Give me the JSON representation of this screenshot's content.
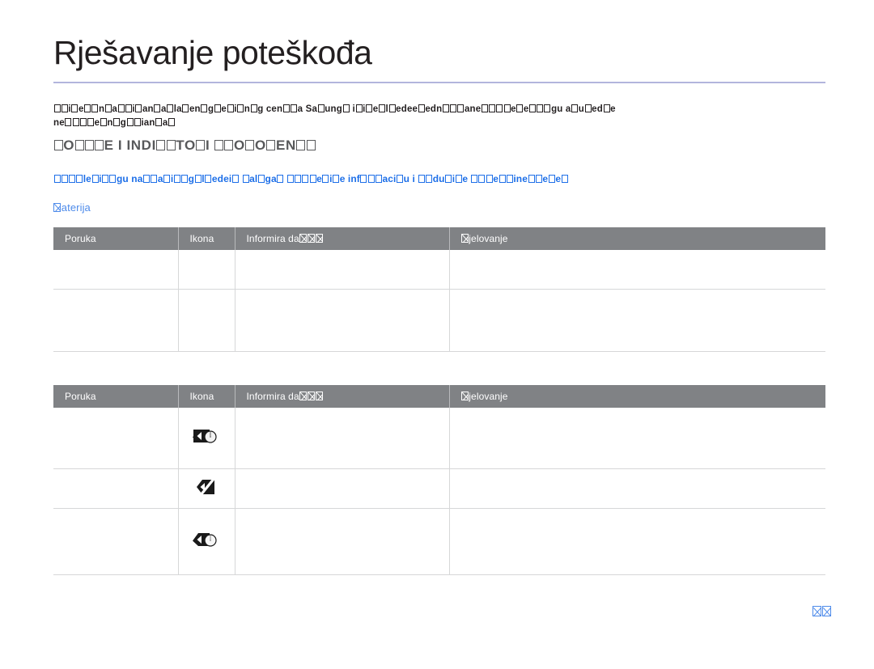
{
  "document": {
    "title": "Rješavanje poteškođa",
    "language": "hr",
    "rule_color": "#b2b5dd",
    "page_number_glyphs": 2
  },
  "intro": {
    "line1_parts": [
      {
        "t": "tofu",
        "n": 2
      },
      {
        "t": "text",
        "v": "i"
      },
      {
        "t": "tofu",
        "n": 1
      },
      {
        "t": "text",
        "v": "e"
      },
      {
        "t": "tofu",
        "n": 2
      },
      {
        "t": "text",
        "v": "n"
      },
      {
        "t": "tofu",
        "n": 1
      },
      {
        "t": "text",
        "v": "a"
      },
      {
        "t": "tofu",
        "n": 2
      },
      {
        "t": "text",
        "v": "i"
      },
      {
        "t": "tofu",
        "n": 1
      },
      {
        "t": "text",
        "v": "an"
      },
      {
        "t": "tofu",
        "n": 1
      },
      {
        "t": "text",
        "v": "a"
      },
      {
        "t": "tofu",
        "n": 1
      },
      {
        "t": "text",
        "v": "la"
      },
      {
        "t": "tofu",
        "n": 1
      },
      {
        "t": "text",
        "v": "en"
      },
      {
        "t": "tofu",
        "n": 1
      },
      {
        "t": "text",
        "v": "g"
      },
      {
        "t": "tofu",
        "n": 1
      },
      {
        "t": "text",
        "v": "e"
      },
      {
        "t": "tofu",
        "n": 1
      },
      {
        "t": "text",
        "v": "i"
      },
      {
        "t": "tofu",
        "n": 1
      },
      {
        "t": "text",
        "v": "n"
      },
      {
        "t": "tofu",
        "n": 1
      },
      {
        "t": "text",
        "v": "g cen"
      },
      {
        "t": "tofu",
        "n": 2
      },
      {
        "t": "text",
        "v": "a Sa"
      },
      {
        "t": "tofu",
        "n": 1
      },
      {
        "t": "text",
        "v": "ung"
      },
      {
        "t": "tofu",
        "n": 1
      },
      {
        "t": "text",
        "v": " i"
      },
      {
        "t": "tofu",
        "n": 1
      },
      {
        "t": "text",
        "v": "i"
      },
      {
        "t": "tofu",
        "n": 1
      },
      {
        "t": "text",
        "v": "e"
      },
      {
        "t": "tofu",
        "n": 1
      },
      {
        "t": "text",
        "v": "l"
      },
      {
        "t": "tofu",
        "n": 1
      },
      {
        "t": "text",
        "v": "edee"
      },
      {
        "t": "tofu",
        "n": 1
      },
      {
        "t": "text",
        "v": "edn"
      },
      {
        "t": "tofu",
        "n": 3
      },
      {
        "t": "text",
        "v": "ane"
      },
      {
        "t": "tofu",
        "n": 4
      },
      {
        "t": "text",
        "v": "e"
      },
      {
        "t": "tofu",
        "n": 1
      },
      {
        "t": "text",
        "v": "e"
      },
      {
        "t": "tofu",
        "n": 3
      },
      {
        "t": "text",
        "v": "gu a"
      },
      {
        "t": "tofu",
        "n": 1
      },
      {
        "t": "text",
        "v": "u"
      },
      {
        "t": "tofu",
        "n": 1
      },
      {
        "t": "text",
        "v": "ed"
      },
      {
        "t": "tofu",
        "n": 1
      },
      {
        "t": "text",
        "v": "e"
      }
    ],
    "line2_parts": [
      {
        "t": "text",
        "v": "ne"
      },
      {
        "t": "tofu",
        "n": 4
      },
      {
        "t": "text",
        "v": "e"
      },
      {
        "t": "tofu",
        "n": 1
      },
      {
        "t": "text",
        "v": "n"
      },
      {
        "t": "tofu",
        "n": 1
      },
      {
        "t": "text",
        "v": "g"
      },
      {
        "t": "tofu",
        "n": 2
      },
      {
        "t": "text",
        "v": "ian"
      },
      {
        "t": "tofu",
        "n": 1
      },
      {
        "t": "text",
        "v": "a"
      },
      {
        "t": "tofu",
        "n": 1
      }
    ]
  },
  "section": {
    "heading_parts": [
      {
        "t": "tofu",
        "n": 1
      },
      {
        "t": "text",
        "v": "O"
      },
      {
        "t": "tofu",
        "n": 3
      },
      {
        "t": "text",
        "v": "E I INDI"
      },
      {
        "t": "tofu",
        "n": 2
      },
      {
        "t": "text",
        "v": "TO"
      },
      {
        "t": "tofu",
        "n": 1
      },
      {
        "t": "text",
        "v": "I "
      },
      {
        "t": "tofu",
        "n": 2
      },
      {
        "t": "text",
        "v": "O"
      },
      {
        "t": "tofu",
        "n": 1
      },
      {
        "t": "text",
        "v": "O"
      },
      {
        "t": "tofu",
        "n": 1
      },
      {
        "t": "text",
        "v": "EN"
      },
      {
        "t": "tofu",
        "n": 2
      }
    ],
    "heading_color": "#58595b"
  },
  "note": {
    "color": "#1d6fe8",
    "parts": [
      {
        "t": "tofu",
        "n": 4
      },
      {
        "t": "text",
        "v": "le"
      },
      {
        "t": "tofu",
        "n": 1
      },
      {
        "t": "text",
        "v": "i"
      },
      {
        "t": "tofu",
        "n": 2
      },
      {
        "t": "text",
        "v": "gu na"
      },
      {
        "t": "tofu",
        "n": 2
      },
      {
        "t": "text",
        "v": "a"
      },
      {
        "t": "tofu",
        "n": 1
      },
      {
        "t": "text",
        "v": "i"
      },
      {
        "t": "tofu",
        "n": 2
      },
      {
        "t": "text",
        "v": "g"
      },
      {
        "t": "tofu",
        "n": 1
      },
      {
        "t": "text",
        "v": "l"
      },
      {
        "t": "tofu",
        "n": 1
      },
      {
        "t": "text",
        "v": "edei"
      },
      {
        "t": "tofu",
        "n": 1
      },
      {
        "t": "text",
        "v": " "
      },
      {
        "t": "tofu",
        "n": 1
      },
      {
        "t": "text",
        "v": "al"
      },
      {
        "t": "tofu",
        "n": 1
      },
      {
        "t": "text",
        "v": "ga"
      },
      {
        "t": "tofu",
        "n": 1
      },
      {
        "t": "text",
        "v": " "
      },
      {
        "t": "tofu",
        "n": 4
      },
      {
        "t": "text",
        "v": "e"
      },
      {
        "t": "tofu",
        "n": 1
      },
      {
        "t": "text",
        "v": "i"
      },
      {
        "t": "tofu",
        "n": 1
      },
      {
        "t": "text",
        "v": "e inf"
      },
      {
        "t": "tofu",
        "n": 3
      },
      {
        "t": "text",
        "v": "aci"
      },
      {
        "t": "tofu",
        "n": 1
      },
      {
        "t": "text",
        "v": "u i "
      },
      {
        "t": "tofu",
        "n": 2
      },
      {
        "t": "text",
        "v": "du"
      },
      {
        "t": "tofu",
        "n": 1
      },
      {
        "t": "text",
        "v": "i"
      },
      {
        "t": "tofu",
        "n": 1
      },
      {
        "t": "text",
        "v": "e "
      },
      {
        "t": "tofu",
        "n": 3
      },
      {
        "t": "text",
        "v": "e"
      },
      {
        "t": "tofu",
        "n": 2
      },
      {
        "t": "text",
        "v": "ine"
      },
      {
        "t": "tofu",
        "n": 2
      },
      {
        "t": "text",
        "v": "e"
      },
      {
        "t": "tofu",
        "n": 1
      },
      {
        "t": "text",
        "v": "e"
      },
      {
        "t": "tofu",
        "n": 1
      }
    ]
  },
  "subheading": {
    "color": "#4e8bea",
    "parts": [
      {
        "t": "tofu-x",
        "n": 1
      },
      {
        "t": "text",
        "v": "aterija"
      }
    ]
  },
  "tables": [
    {
      "id": "table-battery-messages-1",
      "header_bg": "#808285",
      "columns": [
        {
          "key": "poruka",
          "parts": [
            {
              "t": "text",
              "v": "Poruka"
            }
          ]
        },
        {
          "key": "ikona",
          "parts": [
            {
              "t": "text",
              "v": "Ikona"
            }
          ]
        },
        {
          "key": "informira",
          "parts": [
            {
              "t": "text",
              "v": "Informira da"
            },
            {
              "t": "tofu-x",
              "n": 3
            }
          ]
        },
        {
          "key": "djelovanje",
          "parts": [
            {
              "t": "tofu-x",
              "n": 1
            },
            {
              "t": "text",
              "v": "jelovanje"
            }
          ]
        }
      ],
      "rows": [
        {
          "poruka": "",
          "icon": "",
          "informira": "",
          "djelovanje": ""
        },
        {
          "poruka": "",
          "icon": "",
          "informira": "",
          "djelovanje": ""
        }
      ]
    },
    {
      "id": "table-battery-messages-2",
      "header_bg": "#808285",
      "columns": [
        {
          "key": "poruka",
          "parts": [
            {
              "t": "text",
              "v": "Poruka"
            }
          ]
        },
        {
          "key": "ikona",
          "parts": [
            {
              "t": "text",
              "v": "Ikona"
            }
          ]
        },
        {
          "key": "informira",
          "parts": [
            {
              "t": "text",
              "v": "Informira da"
            },
            {
              "t": "tofu-x",
              "n": 3
            }
          ]
        },
        {
          "key": "djelovanje",
          "parts": [
            {
              "t": "tofu-x",
              "n": 1
            },
            {
              "t": "text",
              "v": "jelovanje"
            }
          ]
        }
      ],
      "rows": [
        {
          "poruka": "",
          "icon": "battery-low-gauge-icon",
          "informira": "",
          "djelovanje": ""
        },
        {
          "poruka": "",
          "icon": "battery-slash-icon",
          "informira": "",
          "djelovanje": ""
        },
        {
          "poruka": "",
          "icon": "battery-empty-gauge-icon",
          "informira": "",
          "djelovanje": ""
        }
      ]
    }
  ]
}
